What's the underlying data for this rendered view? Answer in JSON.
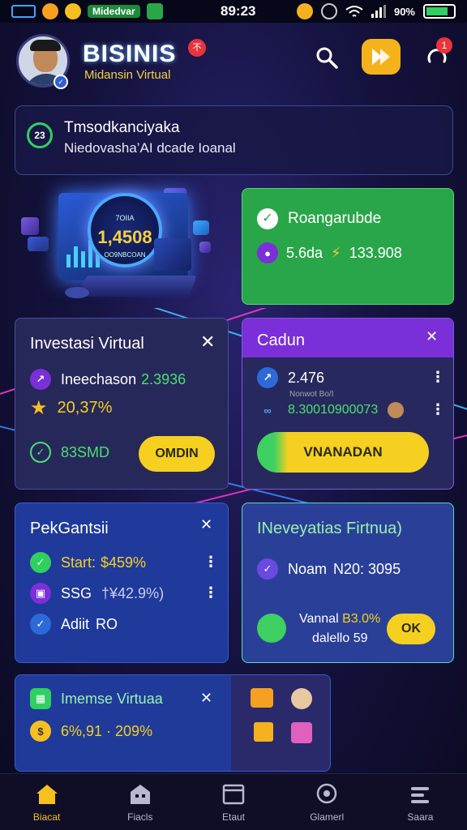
{
  "status_bar": {
    "time": "89:23",
    "carrier_pill": "Midedvar",
    "battery": "90%"
  },
  "header": {
    "brand": "BISINIS",
    "brand_badge": "不",
    "subtitle": "Midansin Virtual",
    "notification_count": "1"
  },
  "banner": {
    "title": "Tmsodkanciyaka",
    "subtitle": "Niedovasha’AI dcade Ioanal",
    "icon_text": "23"
  },
  "hero": {
    "top_text": "7OIIA",
    "value": "1,4508",
    "caption": "OO9NBCOAN"
  },
  "green_card": {
    "line1": "Roangarubde",
    "line2_a": "5.6da",
    "line2_b": "133.908"
  },
  "invest_card": {
    "title": "Investasi Virtual",
    "row1_label": "Ineechason",
    "row1_value": "2.3936",
    "row2_value": "20,37%",
    "row3_value": "83SMD",
    "button": "OMDIN"
  },
  "purple_card": {
    "title": "Cadun",
    "row1_value": "2.476",
    "row2_small": "Nonwot  Bo/I",
    "row2_value": "8.30010900073",
    "button": "VNANADAN"
  },
  "blue_card": {
    "title": "PekGantsii",
    "rows": [
      {
        "label": "Start:",
        "value": "$459%"
      },
      {
        "label": "SSG",
        "value": "†¥42.9%)"
      },
      {
        "label": "Adiit",
        "value": "RO"
      }
    ]
  },
  "teal_card": {
    "title": "INeveyatias Firtnua)",
    "row1_label": "Noam",
    "row1_value": "N20: 3095",
    "row2_label": "Vannal",
    "row2_value": "B3.0%",
    "row3": "dalello 59",
    "button": "OK"
  },
  "bottom_card": {
    "title": "Imemse Virtuaa",
    "row1_value": "6%,91 · 209%"
  },
  "nav": {
    "items": [
      "Biacat",
      "Fiacls",
      "Etaut",
      "Glamerl",
      "Saara"
    ]
  },
  "colors": {
    "accent_yellow": "#f5d020",
    "green": "#2aa64a",
    "purple": "#7b2fd8",
    "blue_card": "#1f3a9a"
  }
}
